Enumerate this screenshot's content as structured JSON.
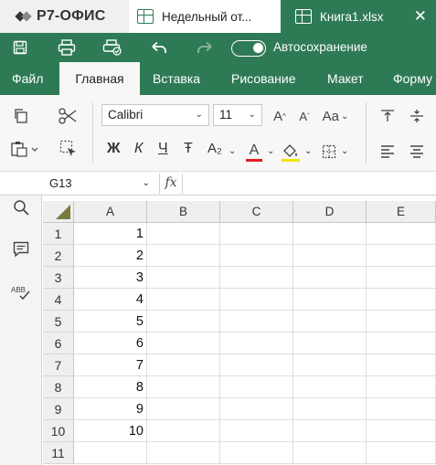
{
  "app": {
    "logo_text": "Р7-ОФИС"
  },
  "tabs": [
    {
      "label": "Недельный от...",
      "icon": "spreadsheet-icon"
    },
    {
      "label": "Книга1.xlsx",
      "icon": "spreadsheet-icon",
      "active": true
    }
  ],
  "quick_access": {
    "autosave_label": "Автосохранение",
    "autosave_on": true
  },
  "menu": [
    "Файл",
    "Главная",
    "Вставка",
    "Рисование",
    "Макет",
    "Форму"
  ],
  "ribbon": {
    "font_name": "Calibri",
    "font_size": "11",
    "bold": "Ж",
    "italic": "К",
    "underline": "Ч",
    "strike": "Ŧ",
    "subscript": "A₂",
    "font_color_letter": "A",
    "font_color": "#e02020",
    "fill_color": "#f2e600"
  },
  "formula_bar": {
    "cell_ref": "G13",
    "fx": "fx",
    "formula": ""
  },
  "sheet": {
    "columns": [
      "A",
      "B",
      "C",
      "D",
      "E"
    ],
    "rows": [
      {
        "num": "1",
        "a": "1"
      },
      {
        "num": "2",
        "a": "2"
      },
      {
        "num": "3",
        "a": "3"
      },
      {
        "num": "4",
        "a": "4"
      },
      {
        "num": "5",
        "a": "5"
      },
      {
        "num": "6",
        "a": "6"
      },
      {
        "num": "7",
        "a": "7"
      },
      {
        "num": "8",
        "a": "8"
      },
      {
        "num": "9",
        "a": "9"
      },
      {
        "num": "10",
        "a": "10"
      },
      {
        "num": "11",
        "a": ""
      }
    ]
  },
  "colors": {
    "brand": "#2e7a55",
    "ribbon_bg": "#f7f7f7",
    "header_bg": "#efefef"
  }
}
